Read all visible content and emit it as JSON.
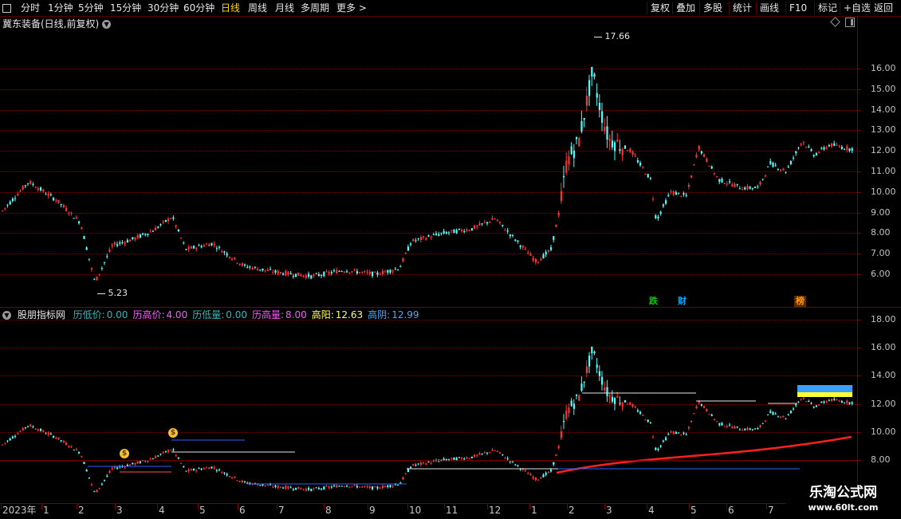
{
  "toolbar": {
    "left_items": [
      "分时",
      "1分钟",
      "5分钟",
      "15分钟",
      "30分钟",
      "60分钟",
      "日线",
      "周线",
      "月线",
      "多周期",
      "更多 >"
    ],
    "active": "日线",
    "right_items": [
      "复权",
      "叠加",
      "多股",
      "统计",
      "画线",
      "F10",
      "标记",
      "+自选",
      "返回"
    ]
  },
  "main_pane": {
    "title": "冀东装备(日线,前复权)",
    "high_label": "17.66",
    "low_label": "5.23",
    "y_ticks": [
      "16.00",
      "15.00",
      "14.00",
      "13.00",
      "12.00",
      "11.00",
      "10.00",
      "9.00",
      "8.00",
      "7.00",
      "6.00"
    ],
    "badges": [
      {
        "text": "跌",
        "color": "#00d000"
      },
      {
        "text": "财",
        "color": "#00aaff"
      },
      {
        "text": "榜",
        "color": "#ff9900"
      }
    ]
  },
  "indicator_pane": {
    "name": "股朋指标网",
    "items": [
      {
        "label": "历低价:",
        "value": "0.00",
        "color": "#3cb4b4"
      },
      {
        "label": "历高价:",
        "value": "4.00",
        "color": "#ff55ff"
      },
      {
        "label": "历低量:",
        "value": "0.00",
        "color": "#3cb4b4"
      },
      {
        "label": "历高量:",
        "value": "8.00",
        "color": "#ff55ff"
      },
      {
        "label": "高阳:",
        "value": "12.63",
        "color": "#ffff66"
      },
      {
        "label": "高阴:",
        "value": "12.99",
        "color": "#4aa8ff"
      }
    ],
    "y_ticks": [
      "18.00",
      "16.00",
      "14.00",
      "12.00",
      "10.00",
      "8.00"
    ]
  },
  "x_axis": {
    "labels": [
      "2023年",
      "1",
      "2",
      "3",
      "4",
      "5",
      "6",
      "7",
      "8",
      "9",
      "10",
      "11",
      "12",
      "1",
      "2",
      "3",
      "4",
      "5",
      "6",
      "7"
    ]
  },
  "watermark": {
    "line1": "乐淘公式网",
    "line2": "www.60lt.com"
  },
  "colors": {
    "up": "#ff3232",
    "down": "#54fcfc",
    "grid": "#5a0000",
    "ma": "#ff2020"
  }
}
